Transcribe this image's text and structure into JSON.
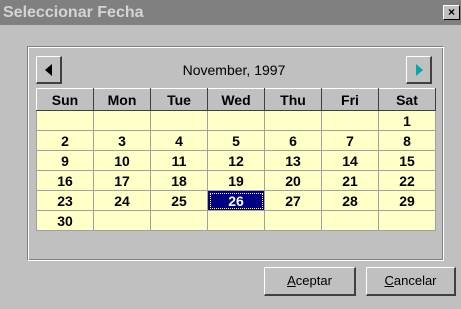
{
  "window": {
    "title": "Seleccionar Fecha",
    "close_glyph": "×"
  },
  "nav": {
    "month_year": "November, 1997",
    "prev_icon": "arrow-left-icon",
    "next_icon": "arrow-right-icon"
  },
  "calendar": {
    "weekdays": [
      "Sun",
      "Mon",
      "Tue",
      "Wed",
      "Thu",
      "Fri",
      "Sat"
    ],
    "weeks": [
      [
        "",
        "",
        "",
        "",
        "",
        "",
        "1"
      ],
      [
        "2",
        "3",
        "4",
        "5",
        "6",
        "7",
        "8"
      ],
      [
        "9",
        "10",
        "11",
        "12",
        "13",
        "14",
        "15"
      ],
      [
        "16",
        "17",
        "18",
        "19",
        "20",
        "21",
        "22"
      ],
      [
        "23",
        "24",
        "25",
        "26",
        "27",
        "28",
        "29"
      ],
      [
        "30",
        "",
        "",
        "",
        "",
        "",
        ""
      ]
    ],
    "selected_day": "26"
  },
  "buttons": {
    "accept": {
      "mnemonic": "A",
      "rest": "ceptar"
    },
    "cancel": {
      "mnemonic": "C",
      "rest": "ancelar"
    }
  },
  "colors": {
    "cell_bg": "#ffffc8",
    "selected_bg": "#000080",
    "titlebar_bg": "#808080"
  }
}
